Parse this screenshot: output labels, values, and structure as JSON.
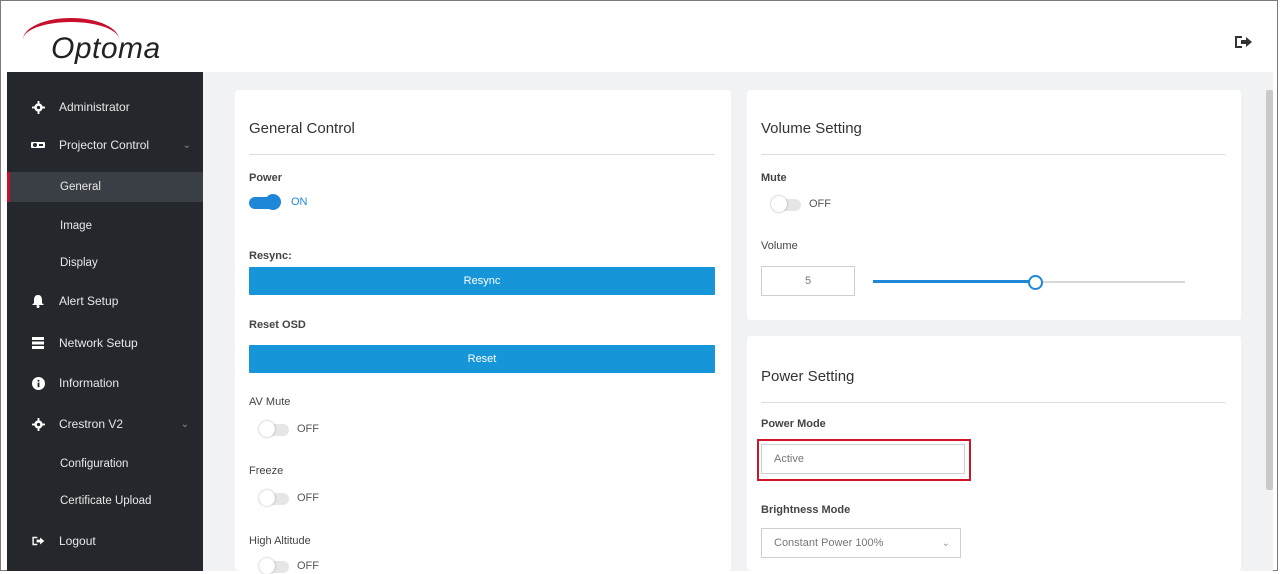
{
  "header": {
    "logo_text": "Optoma",
    "logout_icon": "sign-out-icon"
  },
  "sidebar": {
    "items": [
      {
        "label": "Administrator",
        "icon": "gear-icon"
      },
      {
        "label": "Projector Control",
        "icon": "projector-icon"
      },
      {
        "label": "General"
      },
      {
        "label": "Image"
      },
      {
        "label": "Display"
      },
      {
        "label": "Alert Setup",
        "icon": "bell-icon"
      },
      {
        "label": "Network Setup",
        "icon": "network-icon"
      },
      {
        "label": "Information",
        "icon": "info-icon"
      },
      {
        "label": "Crestron V2",
        "icon": "gear-icon"
      },
      {
        "label": "Configuration"
      },
      {
        "label": "Certificate Upload"
      },
      {
        "label": "Logout",
        "icon": "sign-out-icon"
      }
    ],
    "active": "General"
  },
  "general": {
    "title": "General Control",
    "power_label": "Power",
    "power_state": "ON",
    "resync_label": "Resync:",
    "resync_button": "Resync",
    "reset_label": "Reset OSD",
    "reset_button": "Reset",
    "avmute_label": "AV Mute",
    "avmute_state": "OFF",
    "freeze_label": "Freeze",
    "freeze_state": "OFF",
    "altitude_label": "High Altitude",
    "altitude_state": "OFF"
  },
  "volume": {
    "title": "Volume Setting",
    "mute_label": "Mute",
    "mute_state": "OFF",
    "volume_label": "Volume",
    "volume_value": "5",
    "slider_level": 0.52
  },
  "power": {
    "title": "Power Setting",
    "mode_label": "Power Mode",
    "mode_value": "Active",
    "brightness_label": "Brightness Mode",
    "brightness_value": "Constant Power 100%"
  },
  "colors": {
    "accent": "#1f87d8",
    "button": "#1795d9",
    "sidebar": "#24282c",
    "highlight": "#d0142a",
    "brand": "#c8102e"
  }
}
